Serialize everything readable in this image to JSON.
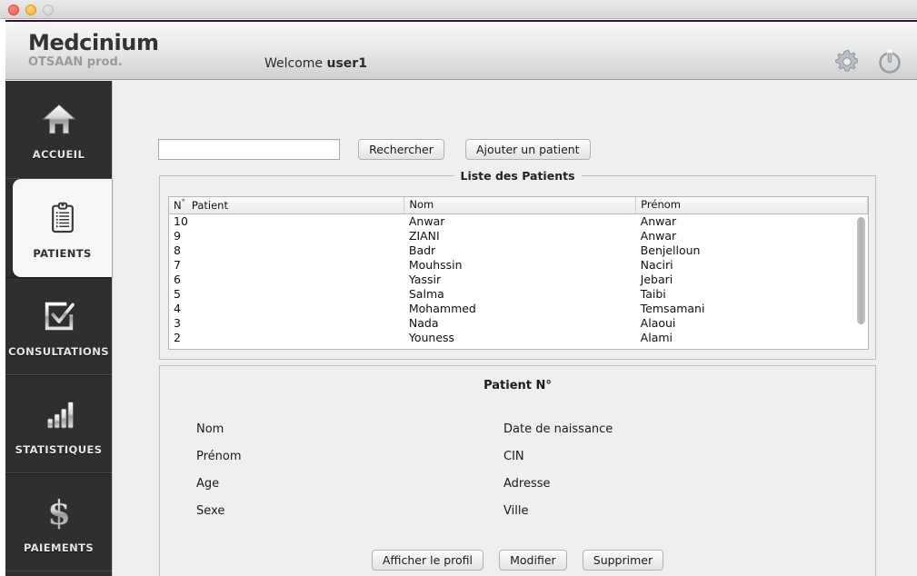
{
  "window": {
    "traffic_lights": [
      "close",
      "minimize",
      "zoom"
    ]
  },
  "header": {
    "app_title": "Medcinium",
    "app_subtitle": "OTSAAN prod.",
    "welcome_prefix": "Welcome",
    "username": "user1",
    "icons": [
      "gear-icon",
      "power-icon"
    ]
  },
  "sidebar": {
    "items": [
      {
        "label": "ACCUEIL",
        "icon": "home-icon",
        "active": false
      },
      {
        "label": "PATIENTS",
        "icon": "clipboard-icon",
        "active": true
      },
      {
        "label": "CONSULTATIONS",
        "icon": "check-box-icon",
        "active": false
      },
      {
        "label": "STATISTIQUES",
        "icon": "bar-chart-icon",
        "active": false
      },
      {
        "label": "PAIEMENTS",
        "icon": "dollar-icon",
        "active": false
      }
    ]
  },
  "toolbar": {
    "search_value": "",
    "search_placeholder": "",
    "search_label": "Rechercher",
    "add_label": "Ajouter un patient"
  },
  "liste": {
    "legend": "Liste des Patients",
    "columns": [
      "N°  Patient",
      "Nom",
      "Prénom"
    ],
    "rows": [
      {
        "num": "10",
        "nom": "Anwar",
        "prenom": "Anwar"
      },
      {
        "num": "9",
        "nom": "ZIANI",
        "prenom": "Anwar"
      },
      {
        "num": "8",
        "nom": "Badr",
        "prenom": "Benjelloun"
      },
      {
        "num": "7",
        "nom": "Mouhssin",
        "prenom": "Naciri"
      },
      {
        "num": "6",
        "nom": "Yassir",
        "prenom": "Jebari"
      },
      {
        "num": "5",
        "nom": "Salma",
        "prenom": "Taibi"
      },
      {
        "num": "4",
        "nom": "Mohammed",
        "prenom": "Temsamani"
      },
      {
        "num": "3",
        "nom": "Nada",
        "prenom": "Alaoui"
      },
      {
        "num": "2",
        "nom": "Youness",
        "prenom": "Alami"
      }
    ]
  },
  "detail": {
    "title": "Patient N°",
    "fields_left": [
      "Nom",
      "Prénom",
      "Age",
      "Sexe"
    ],
    "fields_right": [
      "Date de naissance",
      "CIN",
      "Adresse",
      "Ville"
    ],
    "actions": [
      "Afficher le profil",
      "Modifier",
      "Supprimer"
    ]
  },
  "colors": {
    "accent_top_border": "#3a1038",
    "sidebar_bg": "#2f2f2f",
    "content_bg": "#efefef",
    "active_nav_bg": "#f6f6f6"
  }
}
